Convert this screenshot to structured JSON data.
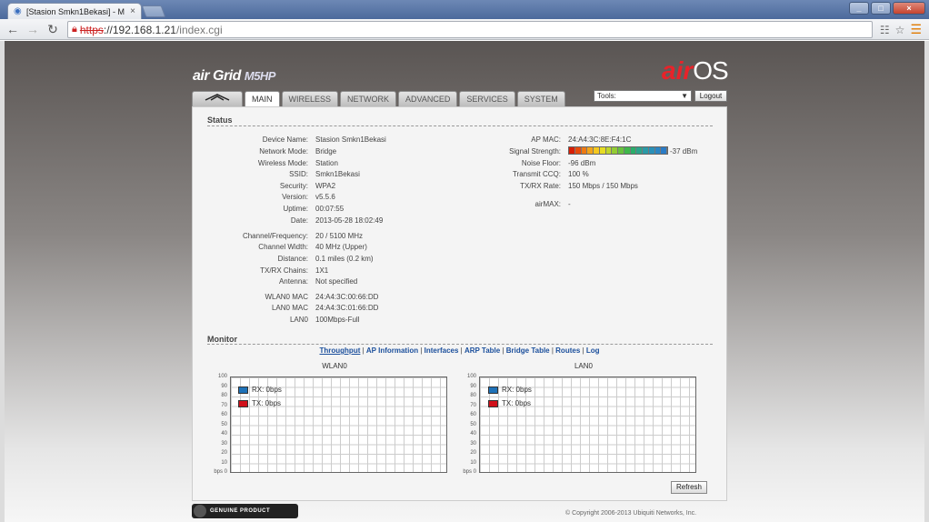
{
  "browser": {
    "tab_title": "[Stasion Smkn1Bekasi] - M",
    "url_scheme": "https",
    "url_host": "://192.168.1.21",
    "url_path": "/index.cgi"
  },
  "header": {
    "brand_left": "air Grid",
    "brand_model": "M5HP",
    "brand_right_air": "air",
    "brand_right_os": "OS",
    "tabs": [
      "MAIN",
      "WIRELESS",
      "NETWORK",
      "ADVANCED",
      "SERVICES",
      "SYSTEM"
    ],
    "tools_value": "Tools:",
    "logout_label": "Logout"
  },
  "status": {
    "title": "Status",
    "left": [
      {
        "label": "Device Name:",
        "value": "Stasion Smkn1Bekasi"
      },
      {
        "label": "Network Mode:",
        "value": "Bridge"
      },
      {
        "label": "Wireless Mode:",
        "value": "Station"
      },
      {
        "label": "SSID:",
        "value": "Smkn1Bekasi"
      },
      {
        "label": "Security:",
        "value": "WPA2"
      },
      {
        "label": "Version:",
        "value": "v5.5.6"
      },
      {
        "label": "Uptime:",
        "value": "00:07:55"
      },
      {
        "label": "Date:",
        "value": "2013-05-28 18:02:49"
      },
      {
        "label": "Channel/Frequency:",
        "value": "20 / 5100 MHz"
      },
      {
        "label": "Channel Width:",
        "value": "40 MHz (Upper)"
      },
      {
        "label": "Distance:",
        "value": "0.1 miles (0.2 km)"
      },
      {
        "label": "TX/RX Chains:",
        "value": "1X1"
      },
      {
        "label": "Antenna:",
        "value": "Not specified"
      },
      {
        "label": "WLAN0 MAC",
        "value": "24:A4:3C:00:66:DD"
      },
      {
        "label": "LAN0 MAC",
        "value": "24:A4:3C:01:66:DD"
      },
      {
        "label": "LAN0",
        "value": "100Mbps-Full"
      }
    ],
    "right": [
      {
        "label": "AP MAC:",
        "value": "24:A4:3C:8E:F4:1C"
      },
      {
        "label": "Signal Strength:",
        "value": "-37 dBm"
      },
      {
        "label": "Noise Floor:",
        "value": "-96 dBm"
      },
      {
        "label": "Transmit CCQ:",
        "value": "100 %"
      },
      {
        "label": "TX/RX Rate:",
        "value": "150 Mbps / 150 Mbps"
      },
      {
        "label": "airMAX:",
        "value": "-"
      }
    ],
    "signal_colors": [
      "#d81e05",
      "#e84a0c",
      "#ee7a12",
      "#f3a51a",
      "#f5c81f",
      "#e6dc23",
      "#bfd62a",
      "#93cc33",
      "#67c23d",
      "#3fb84a",
      "#2aae6a",
      "#2aa48a",
      "#2a9aa6",
      "#2a90b8",
      "#2a86c4",
      "#2a7cc6"
    ]
  },
  "monitor": {
    "title": "Monitor",
    "links": [
      "Throughput",
      "AP Information",
      "Interfaces",
      "ARP Table",
      "Bridge Table",
      "Routes",
      "Log"
    ],
    "graphs": [
      {
        "title": "WLAN0",
        "rx": "RX: 0bps",
        "tx": "TX: 0bps"
      },
      {
        "title": "LAN0",
        "rx": "RX: 0bps",
        "tx": "TX: 0bps"
      }
    ],
    "yticks": [
      "100",
      "90",
      "80",
      "70",
      "60",
      "50",
      "40",
      "30",
      "20",
      "10",
      "bps 0"
    ],
    "rx_color": "#1f72b8",
    "tx_color": "#d0101a",
    "refresh_label": "Refresh"
  },
  "footer": {
    "genuine_label": "GENUINE    PRODUCT",
    "copyright": "© Copyright 2006-2013 Ubiquiti Networks, Inc."
  }
}
